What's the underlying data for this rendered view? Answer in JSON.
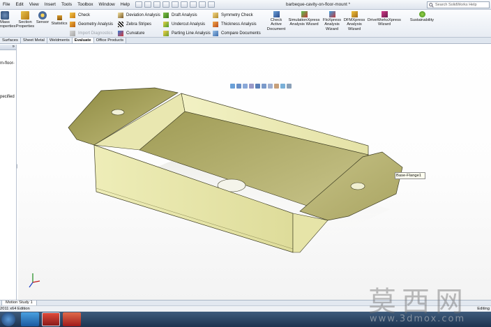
{
  "menubar": {
    "items": [
      "File",
      "Edit",
      "View",
      "Insert",
      "Tools",
      "Toolbox",
      "Window",
      "Help"
    ],
    "doc_title": "barbeque-cavity-on-floor-mount *",
    "search_placeholder": "Search SolidWorks Help"
  },
  "ribbon": {
    "mass_properties": "Mass\nProperties",
    "section_properties": "Section\nProperties",
    "sensor": "Sensor",
    "statistics": "Statistics",
    "col1": [
      "Check",
      "Geometry Analysis",
      "Import Diagnostics"
    ],
    "col2": [
      "Deviation Analysis",
      "Zebra Stripes",
      "Curvature"
    ],
    "col3": [
      "Draft Analysis",
      "Undercut Analysis",
      "Parting Line Analysis"
    ],
    "col4": [
      "Symmetry Check",
      "Thickness Analysis",
      "Compare Documents"
    ],
    "check_active": "Check\nActive\nDocument",
    "simulation": "SimulationXpress\nAnalysis Wizard",
    "floxpress": "FloXpress\nAnalysis\nWizard",
    "dfmxpress": "DFMXpress\nAnalysis\nWizard",
    "driveworks": "DriveWorksXpress\nWizard",
    "sustainability": "Sustainability"
  },
  "tabs": [
    "Surfaces",
    "Sheet Metal",
    "Weldments",
    "Evaluate",
    "Office Products"
  ],
  "active_tab": "Evaluate",
  "leftpanel": {
    "collapse": "»",
    "line1": "m-floor-",
    "line2": "pecified"
  },
  "viewport": {
    "tooltip": "Base-Flange1",
    "part_colors": {
      "wall": "#e8e6a8",
      "floor": "#b8b36a",
      "flange": "#b5b06a",
      "edge": "#3e3d22"
    }
  },
  "motion_tab": "Motion Study 1",
  "status": {
    "left": "2011 x64 Edition",
    "right": "Editing"
  },
  "watermark": {
    "main": "莫西网",
    "sub": "www.3dmox.com"
  }
}
